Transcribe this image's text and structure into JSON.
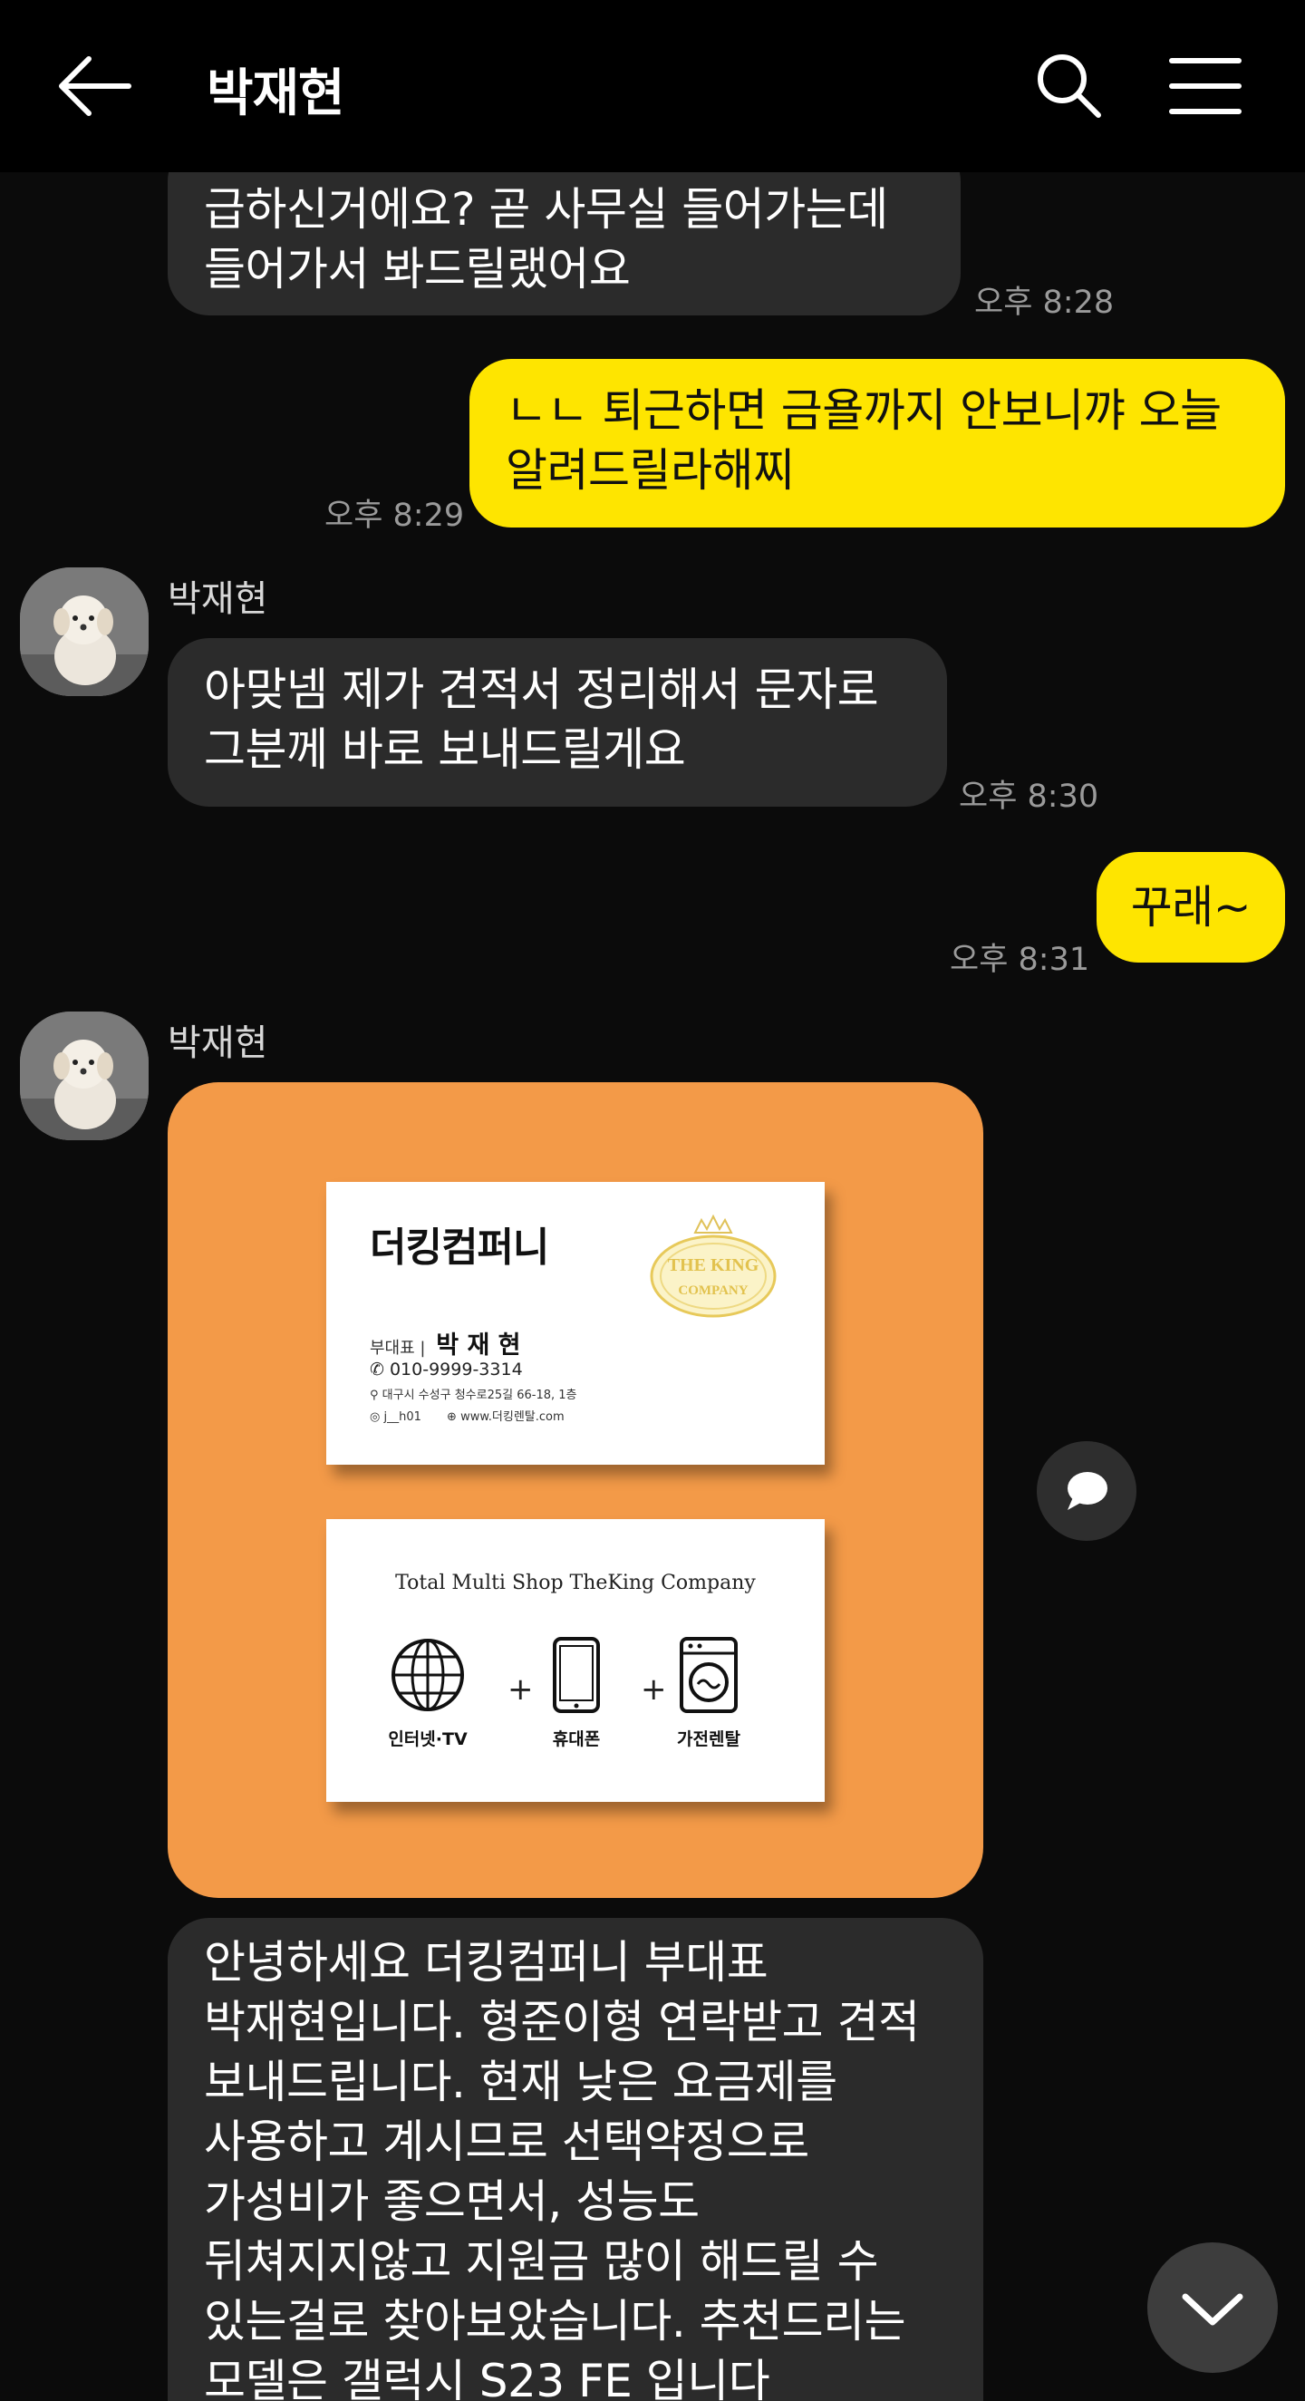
{
  "header": {
    "title": "박재현"
  },
  "messages": [
    {
      "text": "급하신거에요? 곧 사무실 들어가는데\n들어가서 봐드릴랬어요",
      "time": "오후 8:28"
    },
    {
      "text": "ㄴㄴ 퇴근하면 금욜까지 안보니꺄 오늘\n알려드릴라해찌",
      "time": "오후 8:29"
    },
    {
      "sender": "박재현",
      "text": "아맞넴 제가 견적서 정리해서 문자로\n그분께 바로 보내드릴게요",
      "time": "오후 8:30"
    },
    {
      "text": "꾸래~",
      "time": "오후 8:31"
    },
    {
      "sender": "박재현",
      "text": "안녕하세요 더킹컴퍼니 부대표\n박재현입니다. 형준이형 연락받고 견적\n보내드립니다. 현재 낮은 요금제를\n사용하고 계시므로 선택약정으로\n가성비가 좋으면서, 성능도\n뒤쳐지지않고 지원금 많이 해드릴 수\n있는걸로 찾아보았습니다. 추천드리는\n모델은 갤럭시 S23 FE 입니다"
    }
  ],
  "business_card": {
    "company": "더킹컴퍼니",
    "logo_line1": "THE KING",
    "logo_line2": "COMPANY",
    "role": "부대표 |",
    "name": "박 재 현",
    "phone": "010-9999-3314",
    "address": "대구시 수성구 청수로25길 66-18, 1층",
    "instagram": "j__h01",
    "website": "www.더킹렌탈.com",
    "slogan": "Total Multi Shop TheKing Company",
    "services": [
      "인터넷·TV",
      "휴대폰",
      "가전렌탈"
    ],
    "plus": "+"
  },
  "colors": {
    "background": "#0b0b0b",
    "incoming_bubble": "#2b2b2b",
    "outgoing_bubble": "#fee500",
    "image_bg": "#f39a48"
  },
  "icons": [
    "back-arrow-icon",
    "search-icon",
    "menu-icon",
    "chat-bubble-icon",
    "chevron-down-icon"
  ]
}
